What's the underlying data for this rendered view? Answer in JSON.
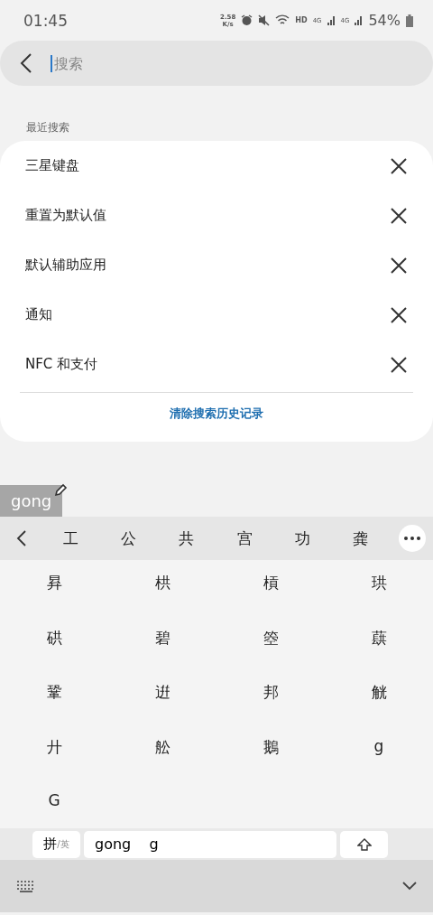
{
  "status_bar": {
    "time": "01:45",
    "speed_value": "2.58",
    "speed_unit": "K/s",
    "hd": "HD",
    "network_1": "4G",
    "network_2": "4G",
    "battery": "54%"
  },
  "search": {
    "placeholder": "搜索"
  },
  "recent": {
    "title": "最近搜索",
    "items": [
      {
        "label": "三星键盘"
      },
      {
        "label": "重置为默认值"
      },
      {
        "label": "默认辅助应用"
      },
      {
        "label": "通知"
      },
      {
        "label": "NFC 和支付"
      }
    ],
    "clear": "清除搜索历史记录"
  },
  "ime": {
    "composing": "gong",
    "candidates": [
      "工",
      "公",
      "共",
      "宫",
      "功",
      "龚"
    ],
    "more": [
      "昪",
      "栱",
      "槓",
      "珙",
      "硔",
      "碧",
      "箜",
      "蕻",
      "鞏",
      "逬",
      "邦",
      "觥",
      "廾",
      "舩",
      "鵝",
      "g",
      "G"
    ],
    "mode_main": "拼",
    "mode_alt": "/英",
    "input": "gong    g"
  }
}
